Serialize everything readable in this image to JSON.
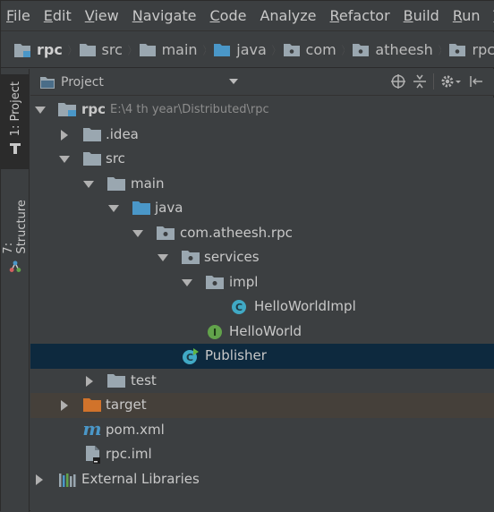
{
  "menu": [
    {
      "mnemonic": "F",
      "rest": "ile"
    },
    {
      "mnemonic": "E",
      "rest": "dit"
    },
    {
      "mnemonic": "V",
      "rest": "iew"
    },
    {
      "mnemonic": "N",
      "rest": "avigate"
    },
    {
      "mnemonic": "C",
      "rest": "ode"
    },
    {
      "mnemonic": "",
      "rest": "Analyze"
    },
    {
      "mnemonic": "R",
      "rest": "efactor"
    },
    {
      "mnemonic": "B",
      "rest": "uild"
    },
    {
      "mnemonic": "R",
      "rest": "un"
    },
    {
      "mnemonic": "T",
      "rest": "oo"
    }
  ],
  "breadcrumb": [
    "rpc",
    "src",
    "main",
    "java",
    "com",
    "atheesh",
    "rpc"
  ],
  "toolstrip": {
    "project_tab": "1: Project",
    "structure_tab": "7: Structure"
  },
  "project_panel": {
    "title": "Project"
  },
  "tree": {
    "root_label": "rpc",
    "root_path": "E:\\4 th year\\Distributed\\rpc",
    "idea": ".idea",
    "src": "src",
    "main": "main",
    "java": "java",
    "package": "com.atheesh.rpc",
    "services": "services",
    "impl": "impl",
    "hello_impl": "HelloWorldImpl",
    "hello_iface": "HelloWorld",
    "publisher": "Publisher",
    "test": "test",
    "target": "target",
    "pom": "pom.xml",
    "iml": "rpc.iml",
    "libraries": "External Libraries"
  },
  "colors": {
    "background": "#3c3f41",
    "selection": "#0d293e",
    "excluded_row": "#45403a",
    "folder": "#9aa7b0",
    "source_folder": "#4a97c8",
    "target_folder": "#d1732b",
    "class_icon": "#40a9c5",
    "interface_icon": "#62a34b"
  }
}
